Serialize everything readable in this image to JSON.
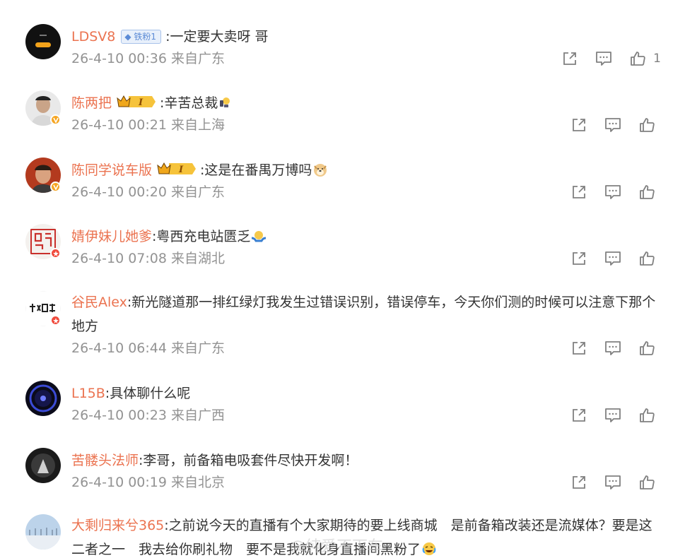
{
  "comments": [
    {
      "username": "LDSV8",
      "badge_text": "铁粉1",
      "text": ":一定要大卖呀 哥",
      "time": "26-4-10 00:36",
      "location": "来自广东",
      "like_count": "1"
    },
    {
      "username": "陈两把",
      "badge_text": "I",
      "text": ":辛苦总裁",
      "time": "26-4-10 00:21",
      "location": "来自上海",
      "like_count": ""
    },
    {
      "username": "陈同学说车版",
      "badge_text": "I",
      "text": ":这是在番禺万博吗",
      "time": "26-4-10 00:20",
      "location": "来自广东",
      "like_count": ""
    },
    {
      "username": "婧伊妹儿她爹",
      "text": ":粤西充电站匮乏",
      "time": "26-4-10 07:08",
      "location": "来自湖北",
      "like_count": ""
    },
    {
      "username": "谷民Alex",
      "text": ":新光隧道那一排红绿灯我发生过错误识别，错误停车，今天你们测的时候可以注意下那个地方",
      "time": "26-4-10 06:44",
      "location": "来自广东",
      "like_count": ""
    },
    {
      "username": "L15B",
      "text": ":具体聊什么呢",
      "time": "26-4-10 00:23",
      "location": "来自广西",
      "like_count": ""
    },
    {
      "username": "苦髅头法师",
      "text": ":李哥，前备箱电吸套件尽快开发啊！",
      "time": "26-4-10 00:19",
      "location": "来自北京",
      "like_count": ""
    },
    {
      "username": "大剩归来兮365",
      "text": ":之前说今天的直播有个大家期待的要上线商城　是前备箱改装还是流媒体？要是这二者之一　我去给你刷礼物　要不是我就化身直播间黑粉了",
      "time": "",
      "location": "",
      "like_count": ""
    }
  ],
  "watermark": "@纯爱不下车",
  "colors": {
    "username": "#eb7350",
    "meta": "#939393",
    "text": "#333333",
    "icon": "#808080"
  }
}
